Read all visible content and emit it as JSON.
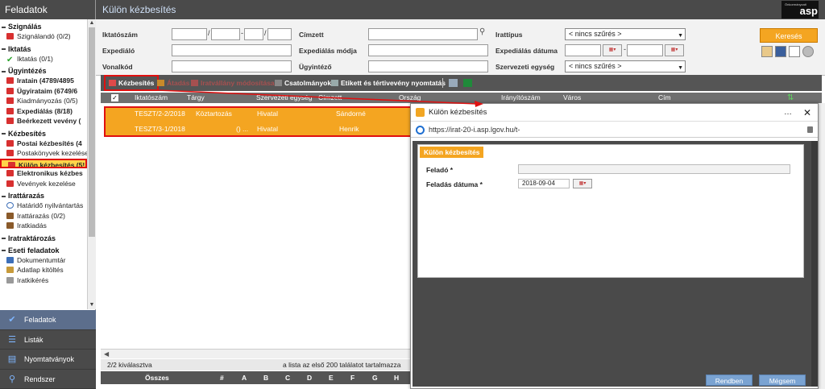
{
  "sidebar": {
    "title": "Feladatok",
    "sections": [
      {
        "label": "Szignálás",
        "items": [
          {
            "label": "Szignálandó (0/2)",
            "icon": "red-doc-icon"
          }
        ]
      },
      {
        "label": "Iktatás",
        "items": [
          {
            "label": "Iktatás (0/1)",
            "icon": "check-icon"
          }
        ]
      },
      {
        "label": "Ügyintézés",
        "items": [
          {
            "label": "Iratain (4789/4895",
            "icon": "red-doc-icon"
          },
          {
            "label": "Ügyirataim (6749/6",
            "icon": "red-doc-icon"
          },
          {
            "label": "Kiadmányozás (0/5)",
            "icon": "red-doc-icon"
          },
          {
            "label": "Expediálás (8/18)",
            "icon": "red-doc-icon"
          },
          {
            "label": "Beérkezett vevény (",
            "icon": "red-doc-icon"
          }
        ]
      },
      {
        "label": "Kézbesítés",
        "items": [
          {
            "label": "Postai kézbesítés (4",
            "icon": "red-doc-icon"
          },
          {
            "label": "Postakönyvek kezelése",
            "icon": "red-doc-icon"
          },
          {
            "label": "Külön kézbesítés (5!",
            "icon": "red-doc-icon"
          },
          {
            "label": "Elektronikus kézbes",
            "icon": "red-doc-icon"
          },
          {
            "label": "Vevények kezelése",
            "icon": "red-doc-icon"
          }
        ]
      },
      {
        "label": "Irattárazás",
        "items": [
          {
            "label": "Határidő nyilvántartás",
            "icon": "clock-icon"
          },
          {
            "label": "Irattárazás (0/2)",
            "icon": "archive-icon"
          },
          {
            "label": "Iratkiadás",
            "icon": "archive-icon"
          }
        ]
      },
      {
        "label": "Iratraktározás",
        "items": []
      },
      {
        "label": "Eseti feladatok",
        "items": [
          {
            "label": "Dokumentumtár",
            "icon": "word-doc-icon"
          },
          {
            "label": "Adatlap kitöltés",
            "icon": "pencil-icon"
          },
          {
            "label": "Iratkikérés",
            "icon": "list-icon"
          }
        ]
      }
    ],
    "nav": [
      "Feladatok",
      "Listák",
      "Nyomtatványok",
      "Rendszer"
    ]
  },
  "main": {
    "title": "Külön kézbesítés",
    "logo_text": "asp",
    "logo_small": "Önkormányzati"
  },
  "filters": {
    "iktatoszam": "Iktatószám",
    "expedialo": "Expediáló",
    "vonalkod": "Vonalkód",
    "cimzett": "Címzett",
    "expedialas_modja": "Expediálás módja",
    "ugyintezo": "Ügyintéző",
    "irattipus": "Irattípus",
    "expedialas_datuma": "Expediálás dátuma",
    "szervezeti_egyseg": "Szervezeti egység",
    "irattipus_value": "< nincs szűrés >",
    "szervezeti_value": "< nincs szűrés >",
    "search_label": "Keresés"
  },
  "toolbar": {
    "kezbesites": "Kézbesítés",
    "atadas": "Átadás",
    "ivhandling": "Iratvállány módosítása",
    "csatolmanyok": "Csatolmányok",
    "etikett": "Etikett és tértivevény nyomtatás"
  },
  "grid": {
    "columns": [
      "Iktatószám",
      "Tárgy",
      "Szervezeti egység",
      "Címzett",
      "Ország",
      "Irányítószám",
      "Város",
      "Cím"
    ],
    "rows": [
      {
        "iktatoszam": "TESZT/2-2/2018",
        "targy": "Köztartozás",
        "egyseg": "Hivatal",
        "cimzett": "Sándorné"
      },
      {
        "iktatoszam": "TESZT/3-1/2018",
        "targy": "() ...",
        "egyseg": "Hivatal",
        "cimzett": "Henrik"
      }
    ],
    "selected_count": "2/2 kiválasztva",
    "limit_note": "a lista az első 200 találatot tartalmazza",
    "alpha_all": "Összes",
    "alpha": [
      "#",
      "A",
      "B",
      "C",
      "D",
      "E",
      "F",
      "G",
      "H"
    ]
  },
  "popup": {
    "title": "Külön kézbesítés",
    "url": "https://irat-20-i.asp.lgov.hu/t-",
    "tab": "Külön kézbesítés",
    "felado_label": "Feladó *",
    "datum_label": "Feladás dátuma *",
    "datum_value": "2018-09-04",
    "rendben": "Rendben",
    "megsem": "Mégsem"
  },
  "colors": {
    "accent": "#f4a521",
    "dark": "#4a4a4a",
    "highlight_red": "#e01010"
  }
}
